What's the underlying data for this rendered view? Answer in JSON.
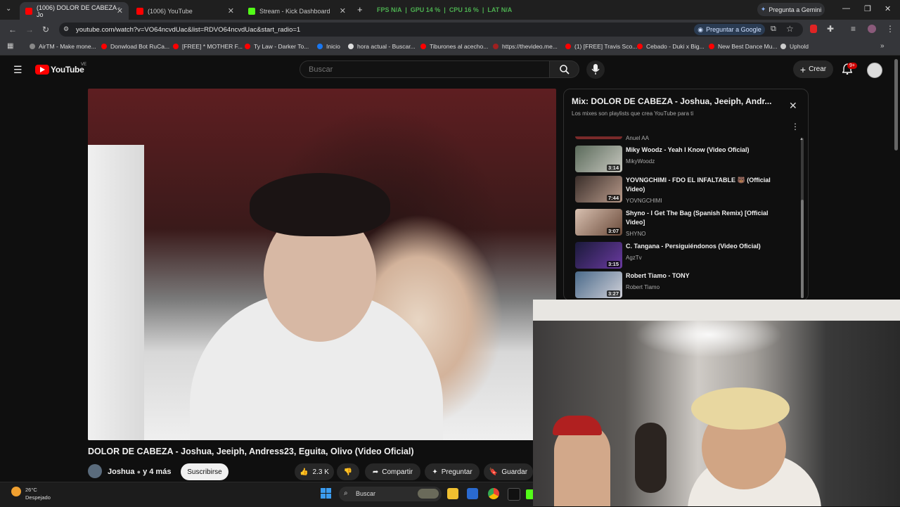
{
  "browser": {
    "tabs": [
      {
        "title": "(1006) DOLOR DE CABEZA - Jo",
        "active": true
      },
      {
        "title": "(1006) YouTube",
        "active": false
      },
      {
        "title": "Stream - Kick Dashboard",
        "active": false
      }
    ],
    "new_tab": "+",
    "stats": {
      "fps_label": "FPS",
      "fps": "N/A",
      "gpu_label": "GPU",
      "gpu": "14 %",
      "cpu_label": "CPU",
      "cpu": "16 %",
      "lat_label": "LAT",
      "lat": "N/A"
    },
    "gemini_label": "Pregunta a Gemini",
    "url": "youtube.com/watch?v=VO64ncvdUac&list=RDVO64ncvdUac&start_radio=1",
    "ask_google": "Preguntar a Google",
    "bookmarks": [
      "AirTM - Make mone...",
      "Donwload Bot RuCa...",
      "[FREE] * MOTHER F...",
      "Ty Law - Darker To...",
      "Inicio",
      "hora actual - Buscar...",
      "Tiburones al acecho...",
      "https://thevideo.me...",
      "(1) [FREE] Travis Sco...",
      "Cebado - Duki x Big...",
      "New Best Dance Mu...",
      "Uphold"
    ]
  },
  "youtube": {
    "logo_text": "YouTube",
    "country_code": "VE",
    "search_placeholder": "Buscar",
    "create_label": "Crear",
    "notifications_badge": "9+",
    "video_title": "DOLOR DE CABEZA - Joshua, Jeeiph, Andress23, Eguita, Olivo (Video Oficial)",
    "channel_name": "Joshua",
    "channel_more": "y 4 más",
    "subscribe_label": "Suscribirse",
    "likes": "2.3 K",
    "share_label": "Compartir",
    "ask_label": "Preguntar",
    "save_label": "Guardar"
  },
  "playlist": {
    "title": "Mix: DOLOR DE CABEZA - Joshua, Jeeiph, Andr...",
    "subtitle": "Los mixes son playlists que crea YouTube para ti",
    "partial_artist": "Anuel AA",
    "items": [
      {
        "title": "Miky Woodz - Yeah I Know (Video Oficial)",
        "artist": "MikyWoodz",
        "duration": "3:14"
      },
      {
        "title": "YOVNGCHIMI - FDO EL INFALTABLE 🐻 (Official Video)",
        "artist": "YOVNGCHIMI",
        "duration": "7:44"
      },
      {
        "title": "Shyno - I Get The Bag (Spanish Remix) [Official Video]",
        "artist": "SHYNO",
        "duration": "3:07"
      },
      {
        "title": "C. Tangana - Persiguiéndonos (Video Oficial)",
        "artist": "AgzTv",
        "duration": "3:15"
      },
      {
        "title": "Robert Tiamo - TONY",
        "artist": "Robert Tiamo",
        "duration": "3:27"
      }
    ]
  },
  "taskbar": {
    "temperature": "26°C",
    "weather": "Despejado",
    "search_placeholder": "Buscar"
  },
  "colors": {
    "accent_red": "#ff0000",
    "stats_green": "#4caf50"
  }
}
